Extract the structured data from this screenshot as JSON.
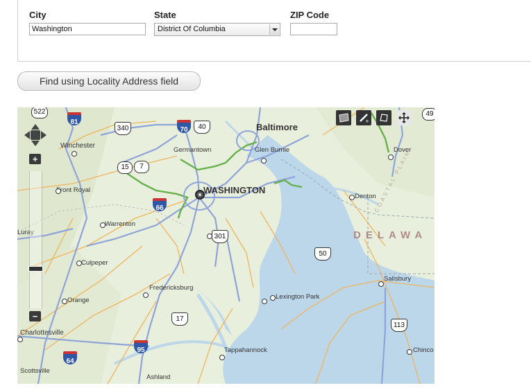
{
  "form": {
    "city_label": "City",
    "city_value": "Washington",
    "state_label": "State",
    "state_value": "District Of Columbia",
    "zip_label": "ZIP Code",
    "zip_value": ""
  },
  "find_button_label": "Find using Locality Address field",
  "map": {
    "places": {
      "baltimore": "Baltimore",
      "washington": "WASHINGTON",
      "winchester": "Winchester",
      "front_royal": "Front Royal",
      "warrenton": "Warrenton",
      "culpeper": "Culpeper",
      "fredericksburg": "Fredericksburg",
      "orange": "Orange",
      "charlottesville": "Charlottesville",
      "scottsville": "Scottsville",
      "ashland": "Ashland",
      "tappahannock": "Tappahannock",
      "lexington_park": "Lexington Park",
      "salisbury": "Salisbury",
      "chincoteague": "Chinco",
      "denton": "Denton",
      "dover": "Dover",
      "glen_burnie": "Glen Burnie",
      "germantown": "Germantown",
      "luray": "Luray",
      "delaware": "DELAWA",
      "coastal_plain": "COASTAL PLAIN"
    },
    "shields": {
      "rt_522": "522",
      "i_81": "81",
      "us_340": "340",
      "i_70": "70",
      "us_40": "40",
      "rt_15": "15",
      "rt_7": "7",
      "i_66": "66",
      "us_301": "301",
      "us_50": "50",
      "us_17": "17",
      "i_95": "95",
      "i_64": "64",
      "us_113": "113",
      "rt_49": "49"
    },
    "zoom_in": "+",
    "zoom_out": "−"
  },
  "colors": {
    "water": "#bcd6ea",
    "land": "#e9efdd",
    "highway": "#8ea4d8",
    "primary_road": "#f0b45a",
    "route_highlight": "#66b04b"
  }
}
